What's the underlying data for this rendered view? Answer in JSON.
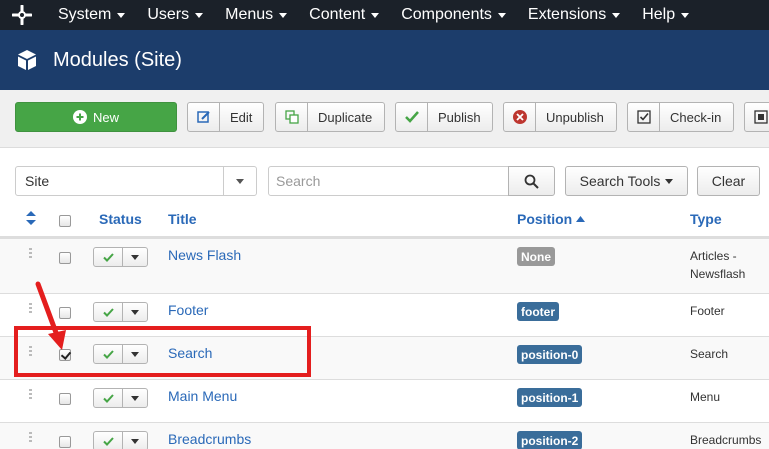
{
  "nav": {
    "items": [
      {
        "label": "System"
      },
      {
        "label": "Users"
      },
      {
        "label": "Menus"
      },
      {
        "label": "Content"
      },
      {
        "label": "Components"
      },
      {
        "label": "Extensions"
      },
      {
        "label": "Help"
      }
    ]
  },
  "header": {
    "title": "Modules (Site)",
    "icon": "cube-icon"
  },
  "toolbar": {
    "new_label": "New",
    "edit_label": "Edit",
    "duplicate_label": "Duplicate",
    "publish_label": "Publish",
    "unpublish_label": "Unpublish",
    "checkin_label": "Check-in"
  },
  "filters": {
    "client_value": "Site",
    "search_placeholder": "Search",
    "search_tools_label": "Search Tools",
    "clear_label": "Clear"
  },
  "table": {
    "columns": {
      "status": "Status",
      "title": "Title",
      "position": "Position",
      "type": "Type"
    },
    "sorted_column": "position",
    "rows": [
      {
        "title": "News Flash",
        "position": "None",
        "type": "Articles - Newsflash",
        "checked": false
      },
      {
        "title": "Footer",
        "position": "footer",
        "type": "Footer",
        "checked": false
      },
      {
        "title": "Search",
        "position": "position-0",
        "type": "Search",
        "checked": true
      },
      {
        "title": "Main Menu",
        "position": "position-1",
        "type": "Menu",
        "checked": false
      },
      {
        "title": "Breadcrumbs",
        "position": "position-2",
        "type": "Breadcrumbs",
        "checked": false
      }
    ]
  },
  "colors": {
    "navbar": "#1b2129",
    "header": "#1c3d6b",
    "new_button": "#46a546",
    "link": "#2a69b8",
    "badge": "#3a6d9a",
    "annotation": "#e41e1e"
  }
}
